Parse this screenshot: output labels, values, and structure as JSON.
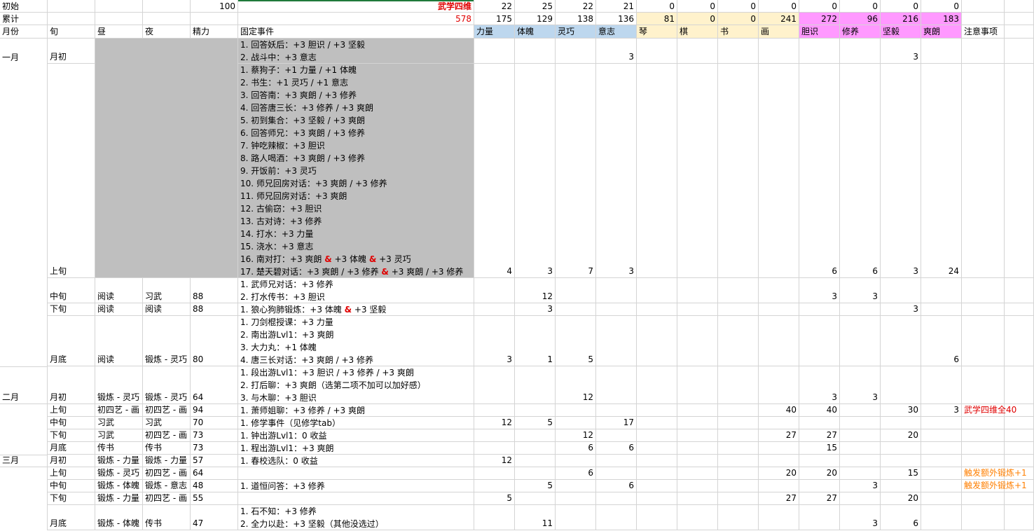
{
  "colors": {
    "stat_header": "#bdd7ee",
    "art_header": "#fff2cc",
    "mind_header": "#ff99ff",
    "gray_block": "#bfbfbf",
    "red_text": "#e00000",
    "orange_text": "#ff7f00"
  },
  "summary": {
    "init_label": "初始",
    "init_value": "100",
    "wuxue_label": "武学四维",
    "init_stats": [
      "22",
      "25",
      "22",
      "21",
      "0",
      "0",
      "0",
      "0",
      "0",
      "0",
      "0",
      "0"
    ],
    "total_label": "累计",
    "total_sum": "578",
    "total_stats": [
      "175",
      "129",
      "138",
      "136",
      "81",
      "0",
      "0",
      "241",
      "272",
      "96",
      "216",
      "183"
    ]
  },
  "headers": {
    "month": "月份",
    "xun": "旬",
    "day": "昼",
    "night": "夜",
    "energy": "精力",
    "events": "固定事件",
    "stats": [
      "力量",
      "体魄",
      "灵巧",
      "意志",
      "琴",
      "棋",
      "书",
      "画",
      "胆识",
      "修养",
      "坚毅",
      "爽朗"
    ],
    "notes": "注意事项"
  },
  "rows": [
    {
      "month": "一月",
      "xun": "月初",
      "day": "",
      "night": "",
      "energy": "",
      "events": [
        "1. 回答妖后：+3 胆识 / +3 坚毅",
        "2. 战斗中：+3 意志"
      ],
      "stats": [
        "",
        "",
        "",
        "3",
        "",
        "",
        "",
        "",
        "",
        "",
        "3",
        ""
      ],
      "note": ""
    },
    {
      "month": "",
      "xun": "上旬",
      "day": "",
      "night": "",
      "energy": "",
      "events": [
        "1. 蔡狗子：+1 力量 / +1 体魄",
        "2. 书生：+1 灵巧 / +1 意志",
        "3. 回答南：+3 爽朗 / +3 修养",
        "4. 回答唐三长：+3 修养 / +3 爽朗",
        "5. 初到集合：+3 坚毅 / +3 爽朗",
        "6. 回答师兄：+3 爽朗 / +3 修养",
        "7. 钟吃辣椒：+3 胆识",
        "8. 路人喝酒：+3 爽朗 / +3 修养",
        "9. 开饭前：+3 灵巧",
        "10. 师兄回房对话：+3 爽朗 / +3 修养",
        "11. 师兄回房对话：+3 爽朗",
        "12. 古偷窃：+3 胆识",
        "13. 古对诗：+3 修养",
        "14. 打水：+3 力量",
        "15. 浇水：+3 意志",
        "16. 南对打：+3 爽朗 & +3 体魄 & +3 灵巧",
        "17. 楚天碧对话：+3 爽朗 / +3 修养 & +3 爽朗 / +3 修养"
      ],
      "stats": [
        "4",
        "3",
        "7",
        "3",
        "",
        "",
        "",
        "",
        "6",
        "6",
        "3",
        "24"
      ],
      "note": ""
    },
    {
      "month": "",
      "xun": "中旬",
      "day": "阅读",
      "night": "习武",
      "energy": "88",
      "events": [
        "1. 武师兄对话：+3 修养",
        "2. 打水传书：+3 胆识"
      ],
      "stats": [
        "",
        "12",
        "",
        "",
        "",
        "",
        "",
        "",
        "3",
        "3",
        "",
        ""
      ],
      "note": ""
    },
    {
      "month": "",
      "xun": "下旬",
      "day": "阅读",
      "night": "阅读",
      "energy": "88",
      "events": [
        "1. 狼心狗肺锻炼：+3 体魄 & +3 坚毅"
      ],
      "stats": [
        "",
        "3",
        "",
        "",
        "",
        "",
        "",
        "",
        "",
        "",
        "3",
        ""
      ],
      "note": ""
    },
    {
      "month": "",
      "xun": "月底",
      "day": "阅读",
      "night": "锻炼 - 灵巧",
      "energy": "80",
      "events": [
        "1. 刀剑棍授课：+3 力量",
        "2. 南出游Lvl1：+3 爽朗",
        "3. 大力丸：+1 体魄",
        "4. 唐三长对话：+3 爽朗 / +3 修养"
      ],
      "stats": [
        "3",
        "1",
        "5",
        "",
        "",
        "",
        "",
        "",
        "",
        "",
        "",
        "6"
      ],
      "note": ""
    },
    {
      "month": "二月",
      "xun": "月初",
      "day": "锻炼 - 灵巧",
      "night": "锻炼 - 灵巧",
      "energy": "64",
      "events": [
        "1. 段出游Lvl1：+3 胆识 / +3 修养 / +3 爽朗",
        "2. 打后聊：+3 爽朗（选第二项不加可以加好感）",
        "3. 与木聊：+3 胆识"
      ],
      "stats": [
        "",
        "",
        "12",
        "",
        "",
        "",
        "",
        "",
        "3",
        "3",
        "",
        ""
      ],
      "note": ""
    },
    {
      "month": "",
      "xun": "上旬",
      "day": "初四艺 - 画",
      "night": "初四艺 - 画",
      "energy": "94",
      "events": [
        "1. 萧师姐聊：+3 修养 / +3 爽朗"
      ],
      "stats": [
        "",
        "",
        "",
        "",
        "",
        "",
        "",
        "40",
        "40",
        "",
        "30",
        "3"
      ],
      "note": "武学四维全40"
    },
    {
      "month": "",
      "xun": "中旬",
      "day": "习武",
      "night": "习武",
      "energy": "70",
      "events": [
        "1. 修学事件（见修学tab）"
      ],
      "stats": [
        "12",
        "5",
        "",
        "17",
        "",
        "",
        "",
        "",
        "",
        "",
        "",
        ""
      ],
      "note": ""
    },
    {
      "month": "",
      "xun": "下旬",
      "day": "习武",
      "night": "初四艺 - 画",
      "energy": "73",
      "events": [
        "1. 钟出游Lvl1：0 收益"
      ],
      "stats": [
        "",
        "",
        "12",
        "",
        "",
        "",
        "",
        "27",
        "27",
        "",
        "20",
        ""
      ],
      "note": ""
    },
    {
      "month": "",
      "xun": "月底",
      "day": "传书",
      "night": "传书",
      "energy": "73",
      "events": [
        "1. 程出游Lvl1：+3 爽朗"
      ],
      "stats": [
        "",
        "",
        "6",
        "6",
        "",
        "",
        "",
        "",
        "15",
        "",
        "",
        ""
      ],
      "note": ""
    },
    {
      "month": "三月",
      "xun": "月初",
      "day": "锻炼 - 力量",
      "night": "锻炼 - 力量",
      "energy": "57",
      "events": [
        "1. 春校选队：0 收益"
      ],
      "stats": [
        "12",
        "",
        "",
        "",
        "",
        "",
        "",
        "",
        "",
        "",
        "",
        ""
      ],
      "note": ""
    },
    {
      "month": "",
      "xun": "上旬",
      "day": "锻炼 - 灵巧",
      "night": "初四艺 - 画",
      "energy": "64",
      "events": [
        ""
      ],
      "stats": [
        "",
        "",
        "6",
        "",
        "",
        "",
        "",
        "20",
        "20",
        "",
        "15",
        ""
      ],
      "note": "触发额外锻炼+1"
    },
    {
      "month": "",
      "xun": "中旬",
      "day": "锻炼 - 体魄",
      "night": "锻炼 - 意志",
      "energy": "48",
      "events": [
        "1. 道恒问答：+3 修养"
      ],
      "stats": [
        "",
        "5",
        "",
        "6",
        "",
        "",
        "",
        "",
        "",
        "3",
        "",
        ""
      ],
      "note": "触发额外锻炼+1"
    },
    {
      "month": "",
      "xun": "下旬",
      "day": "锻炼 - 力量",
      "night": "初四艺 - 画",
      "energy": "55",
      "events": [
        ""
      ],
      "stats": [
        "5",
        "",
        "",
        "",
        "",
        "",
        "",
        "27",
        "27",
        "",
        "20",
        ""
      ],
      "note": ""
    },
    {
      "month": "",
      "xun": "月底",
      "day": "锻炼 - 体魄",
      "night": "传书",
      "energy": "47",
      "events": [
        "1. 石不知：+3 修养",
        "2. 全力以赴：+3 坚毅（其他没选过）"
      ],
      "stats": [
        "",
        "11",
        "",
        "",
        "",
        "",
        "",
        "",
        "",
        "3",
        "6",
        ""
      ],
      "note": ""
    }
  ]
}
